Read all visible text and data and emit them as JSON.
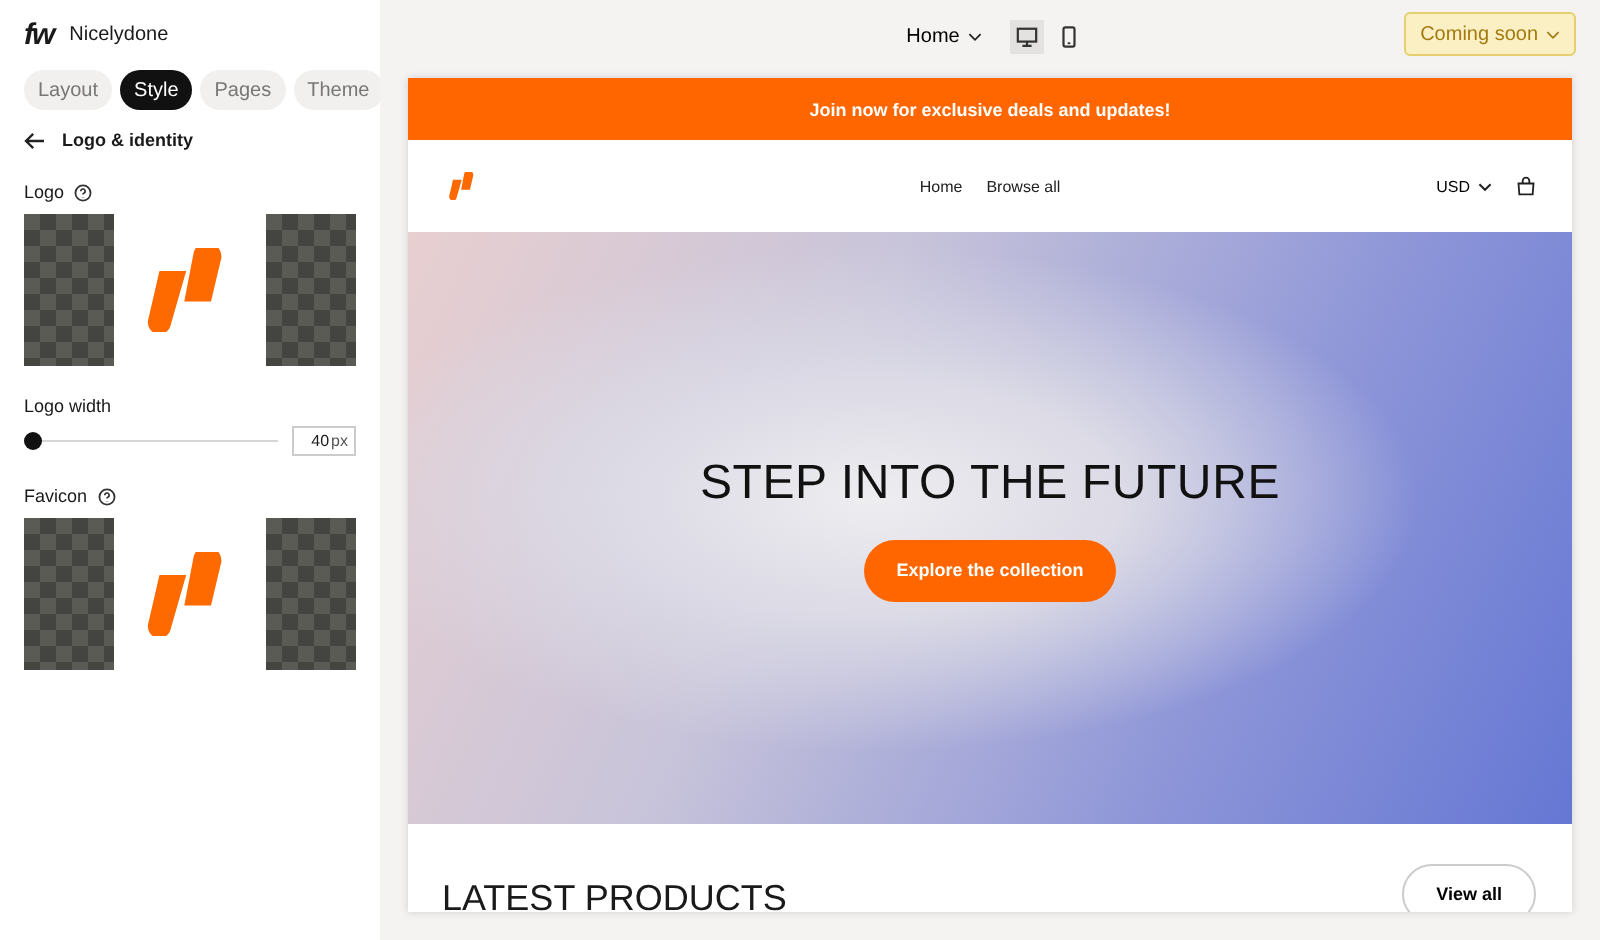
{
  "sidebar": {
    "brand_mark": "fw",
    "brand_name": "Nicelydone",
    "tabs": [
      {
        "label": "Layout",
        "selected": false
      },
      {
        "label": "Style",
        "selected": true
      },
      {
        "label": "Pages",
        "selected": false
      },
      {
        "label": "Theme",
        "selected": false
      }
    ],
    "section_title": "Logo & identity",
    "logo": {
      "label": "Logo"
    },
    "logo_width": {
      "label": "Logo width",
      "level": 0.03,
      "value": "40",
      "unit": "px"
    },
    "favicon": {
      "label": "Favicon"
    }
  },
  "toolbar": {
    "page": "Home",
    "devices": [
      {
        "kind": "desktop",
        "selected": true
      },
      {
        "kind": "mobile",
        "selected": false
      }
    ],
    "status": "Coming soon"
  },
  "preview": {
    "announcement": "Join now for exclusive deals and updates!",
    "nav": [
      "Home",
      "Browse all"
    ],
    "currency": "USD",
    "hero": {
      "title": "STEP INTO THE FUTURE",
      "cta": "Explore the collection"
    },
    "section": {
      "title": "LATEST PRODUCTS",
      "action": "View all"
    }
  }
}
